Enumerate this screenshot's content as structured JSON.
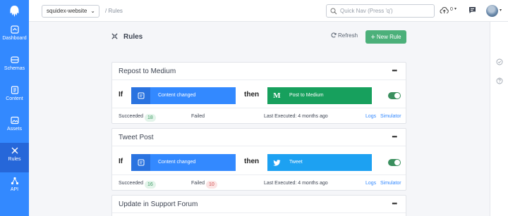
{
  "sidebar": {
    "items": [
      {
        "label": "Dashboard",
        "icon": "dashboard-icon"
      },
      {
        "label": "Schemas",
        "icon": "schemas-icon"
      },
      {
        "label": "Content",
        "icon": "content-icon"
      },
      {
        "label": "Assets",
        "icon": "assets-icon"
      },
      {
        "label": "Rules",
        "icon": "rules-icon",
        "active": true
      },
      {
        "label": "API",
        "icon": "api-icon"
      }
    ]
  },
  "topbar": {
    "app_name": "squidex-website",
    "breadcrumb": "/ Rules",
    "search_placeholder": "Quick Nav (Press 'q')",
    "upload_count": "0"
  },
  "page": {
    "title": "Rules",
    "refresh_label": "Refresh",
    "new_rule_label": "New Rule"
  },
  "rules": [
    {
      "title": "Repost to Medium",
      "if_label": "If",
      "then_label": "then",
      "trigger": "Content changed",
      "action": "Post to Medium",
      "action_icon": "medium-icon",
      "enabled": true,
      "succeeded_label": "Succeeded",
      "succeeded": "18",
      "failed_label": "Failed",
      "failed": "",
      "last_executed": "Last Executed: 4 months ago",
      "logs": "Logs",
      "simulator": "Simulator"
    },
    {
      "title": "Tweet Post",
      "if_label": "If",
      "then_label": "then",
      "trigger": "Content changed",
      "action": "Tweet",
      "action_icon": "twitter-icon",
      "enabled": true,
      "succeeded_label": "Succeeded",
      "succeeded": "16",
      "failed_label": "Failed",
      "failed": "10",
      "last_executed": "Last Executed: 4 months ago",
      "logs": "Logs",
      "simulator": "Simulator"
    },
    {
      "title": "Update in Support Forum"
    }
  ],
  "colors": {
    "sidebar": "#3389ff",
    "trigger_block": "#3389ff",
    "medium_block": "#17a05d",
    "twitter_block": "#1da1f2",
    "new_rule_button": "#4cb07a"
  }
}
